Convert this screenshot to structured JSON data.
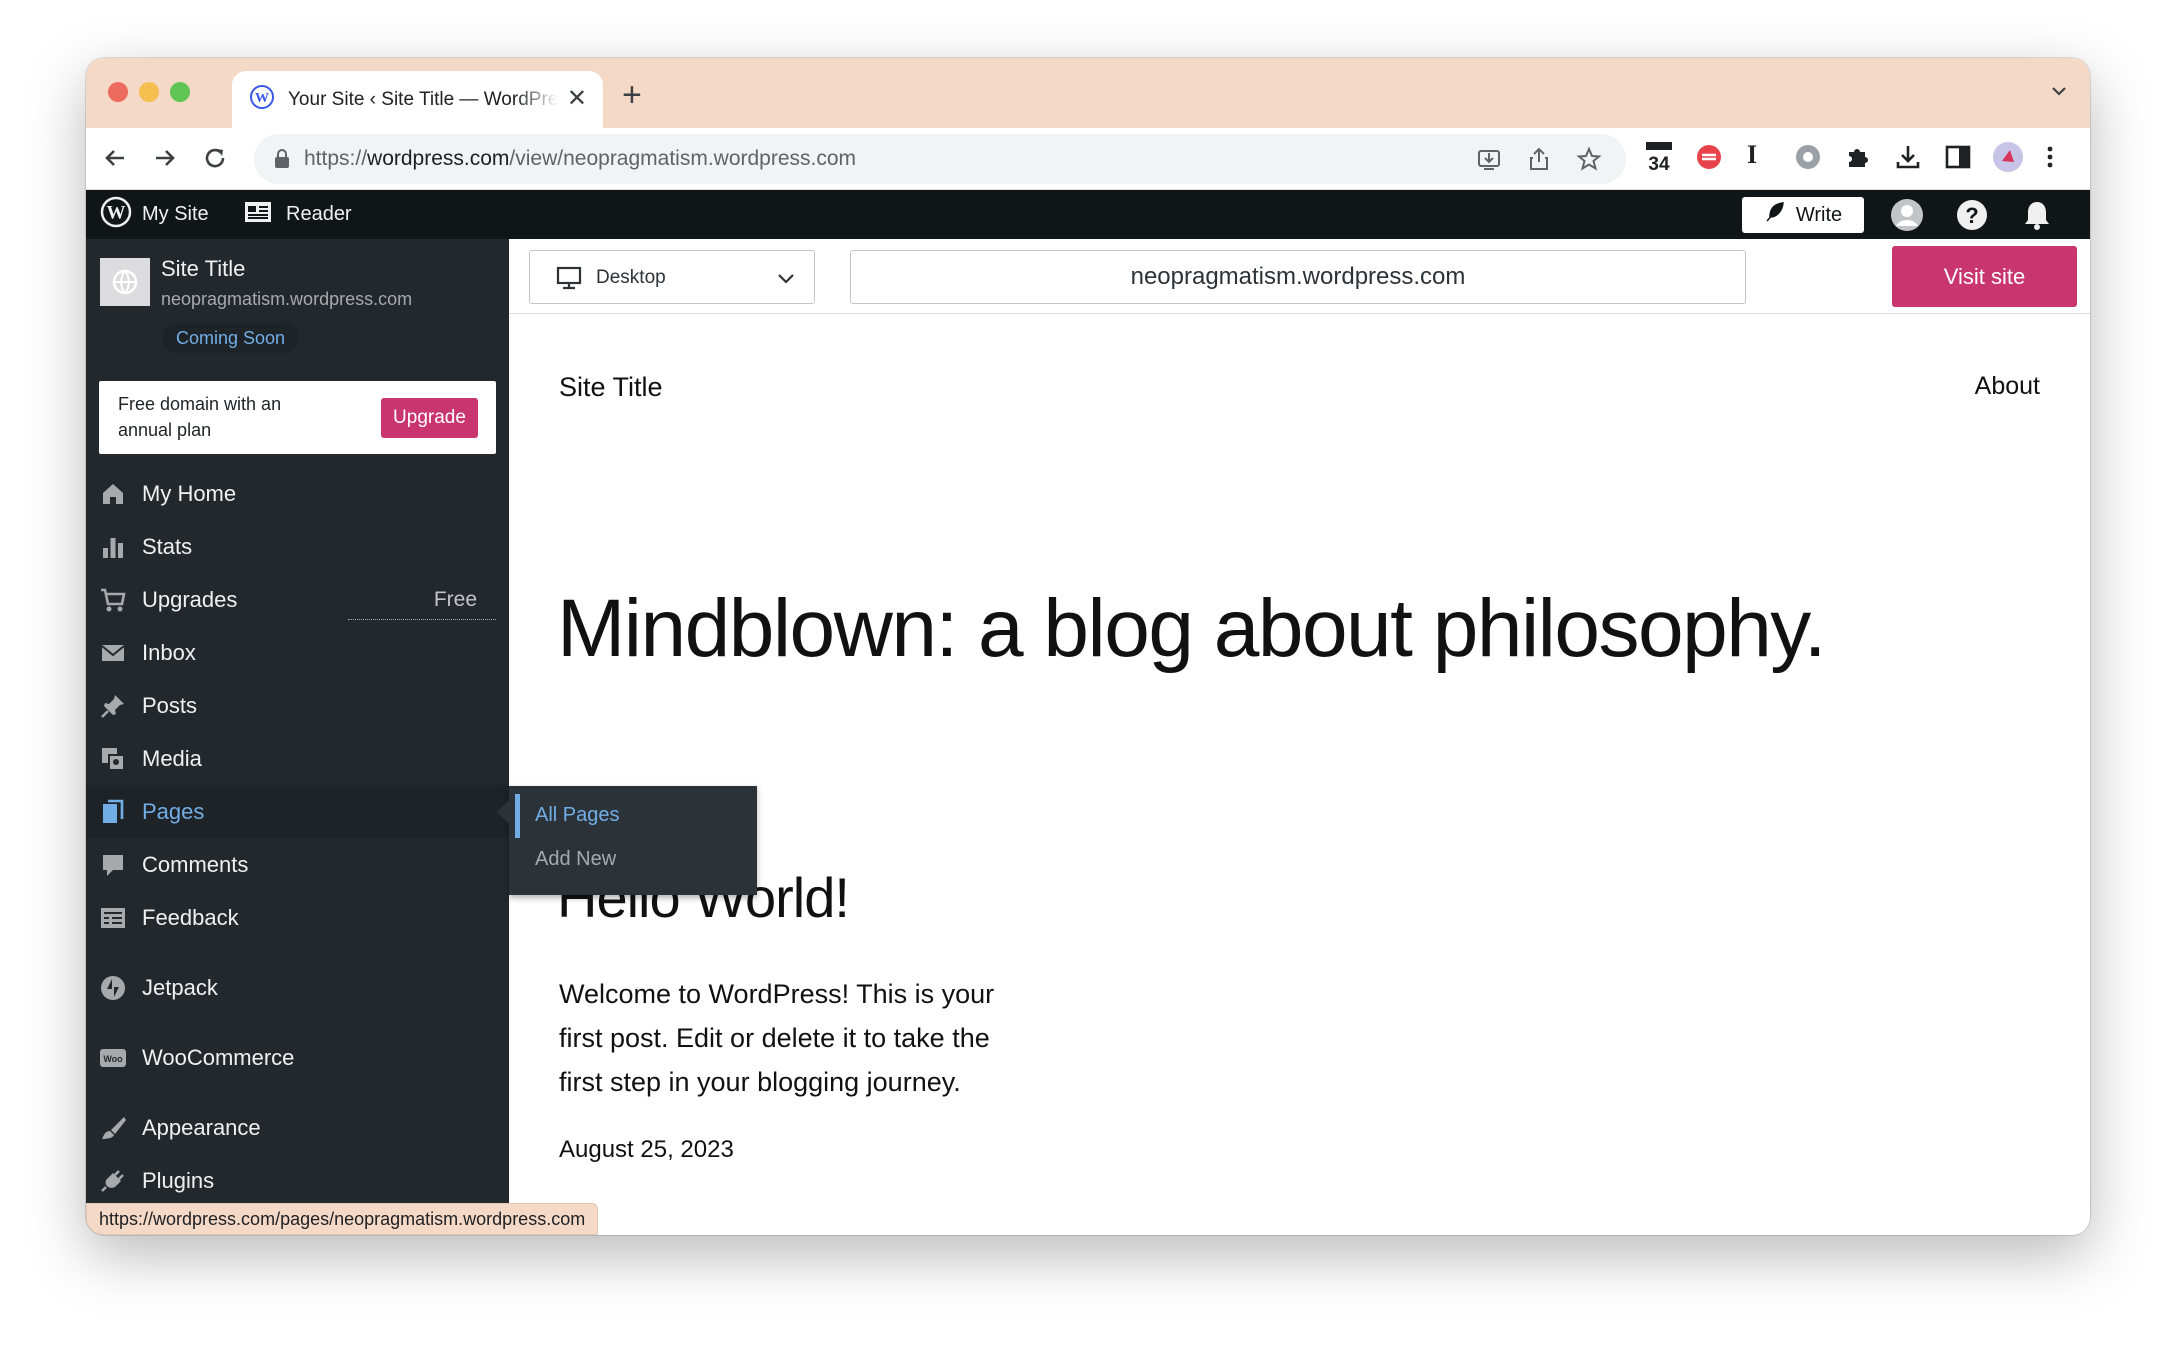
{
  "browser": {
    "tab_title": "Your Site ‹ Site Title — WordPress.com",
    "url_scheme": "https://",
    "url_host": "wordpress.com",
    "url_path": "/view/neopragmatism.wordpress.com",
    "status_url": "https://wordpress.com/pages/neopragmatism.wordpress.com",
    "extension_badge": "34"
  },
  "adminbar": {
    "my_site": "My Site",
    "reader": "Reader",
    "write": "Write"
  },
  "sidebar": {
    "site_title": "Site Title",
    "site_url": "neopragmatism.wordpress.com",
    "badge": "Coming Soon",
    "upsell_text": "Free domain with an annual plan",
    "upsell_button": "Upgrade",
    "items": [
      {
        "label": "My Home",
        "icon": "home-icon"
      },
      {
        "label": "Stats",
        "icon": "stats-icon"
      },
      {
        "label": "Upgrades",
        "icon": "cart-icon",
        "badge": "Free"
      },
      {
        "label": "Inbox",
        "icon": "mail-icon"
      },
      {
        "label": "Posts",
        "icon": "pin-icon"
      },
      {
        "label": "Media",
        "icon": "media-icon"
      },
      {
        "label": "Pages",
        "icon": "pages-icon",
        "active": true
      },
      {
        "label": "Comments",
        "icon": "comment-icon"
      },
      {
        "label": "Feedback",
        "icon": "feedback-icon"
      },
      {
        "label": "Jetpack",
        "icon": "jetpack-icon"
      },
      {
        "label": "WooCommerce",
        "icon": "woo-icon"
      },
      {
        "label": "Appearance",
        "icon": "brush-icon"
      },
      {
        "label": "Plugins",
        "icon": "plug-icon"
      }
    ],
    "flyout": [
      "All Pages",
      "Add New"
    ]
  },
  "preview": {
    "device": "Desktop",
    "address": "neopragmatism.wordpress.com",
    "visit_button": "Visit site"
  },
  "site": {
    "title": "Site Title",
    "nav_about": "About",
    "headline": "Mindblown: a blog about philosophy.",
    "post_title": "Hello World!",
    "excerpt": "Welcome to WordPress! This is your first post. Edit or delete it to take the first step in your blogging journey.",
    "date": "August 25, 2023"
  },
  "colors": {
    "accent": "#c9356e",
    "link": "#72aee6",
    "sidebar_bg": "#23282d",
    "adminbar_bg": "#101517",
    "chrome_tab_strip": "#f5d9c7"
  }
}
